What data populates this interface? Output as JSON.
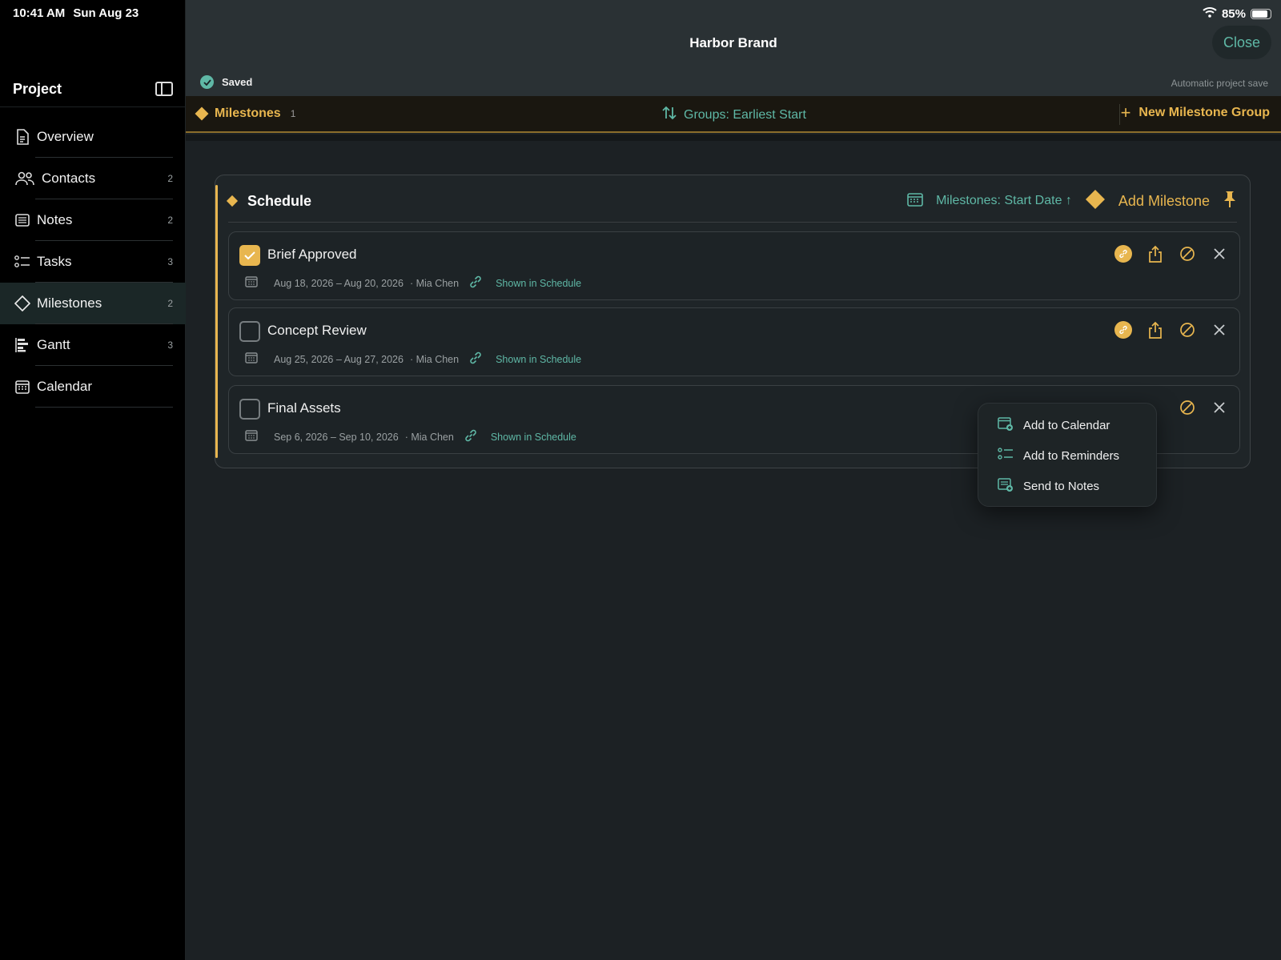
{
  "status": {
    "time": "10:41 AM",
    "date": "Sun Aug 23",
    "battery": "85%"
  },
  "sidebar": {
    "title": "Project",
    "items": [
      {
        "label": "Overview",
        "count": ""
      },
      {
        "label": "Contacts",
        "count": "2"
      },
      {
        "label": "Notes",
        "count": "2"
      },
      {
        "label": "Tasks",
        "count": "3"
      },
      {
        "label": "Milestones",
        "count": "2"
      },
      {
        "label": "Gantt",
        "count": "3"
      },
      {
        "label": "Calendar",
        "count": ""
      }
    ]
  },
  "header": {
    "title": "Harbor Brand",
    "close_label": "Close",
    "saved_label": "Saved",
    "autosave_label": "Automatic project save"
  },
  "toolbar": {
    "milestones_label": "Milestones",
    "milestones_count": "1",
    "groups_label": "Groups: Earliest Start",
    "new_group_label": "New Milestone Group"
  },
  "group": {
    "title": "Schedule",
    "sort_label": "Milestones: Start Date ↑",
    "add_label": "Add Milestone",
    "milestones": [
      {
        "name": "Brief Approved",
        "dates": "Aug 18, 2026 – Aug 20, 2026",
        "owner": "· Mia Chen",
        "visibility": "Shown in Schedule",
        "done": true
      },
      {
        "name": "Concept Review",
        "dates": "Aug 25, 2026 – Aug 27, 2026",
        "owner": "· Mia Chen",
        "visibility": "Shown in Schedule",
        "done": false
      },
      {
        "name": "Final Assets",
        "dates": "Sep 6, 2026 – Sep 10, 2026",
        "owner": "· Mia Chen",
        "visibility": "Shown in Schedule",
        "done": false
      }
    ]
  },
  "menu": {
    "items": [
      "Add to Calendar",
      "Add to Reminders",
      "Send to Notes"
    ]
  },
  "colors": {
    "accent_gold": "#e8b64f",
    "accent_teal": "#5fb8a6"
  }
}
